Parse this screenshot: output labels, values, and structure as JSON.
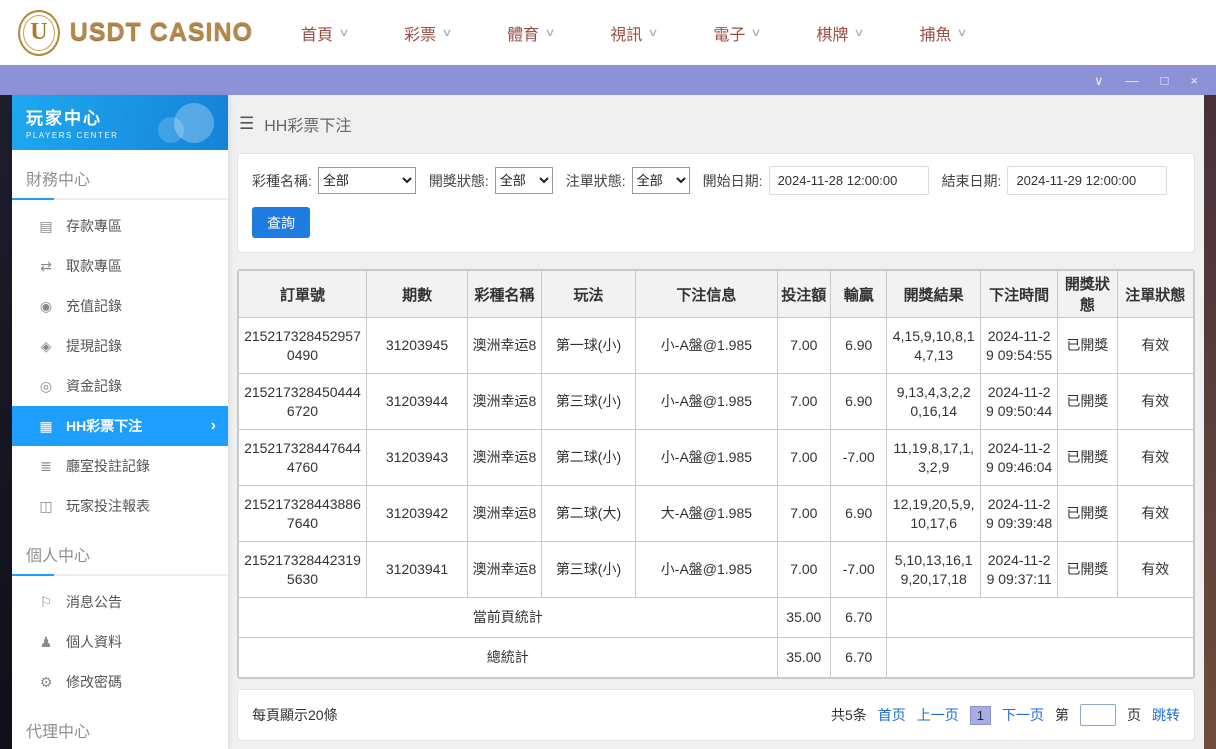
{
  "brand": {
    "logo_text": "USDT CASINO",
    "logo_letter": "U"
  },
  "top_nav": {
    "items": [
      "首頁",
      "彩票",
      "體育",
      "視訊",
      "電子",
      "棋牌",
      "捕魚"
    ]
  },
  "window_controls": {
    "collapse": "∨",
    "minimize": "—",
    "maximize": "□",
    "close": "×"
  },
  "sidebar": {
    "title": "玩家中心",
    "subtitle": "PLAYERS CENTER",
    "sections": [
      {
        "label": "財務中心",
        "items": [
          {
            "label": "存款專區",
            "icon_glyph": "▤"
          },
          {
            "label": "取款專區",
            "icon_glyph": "⇄"
          },
          {
            "label": "充值記錄",
            "icon_glyph": "◉"
          },
          {
            "label": "提現記錄",
            "icon_glyph": "◈"
          },
          {
            "label": "資金記錄",
            "icon_glyph": "◎"
          },
          {
            "label": "HH彩票下注",
            "icon_glyph": "▦",
            "chevron": "›"
          },
          {
            "label": "廳室投註記錄",
            "icon_glyph": "≣"
          },
          {
            "label": "玩家投注報表",
            "icon_glyph": "◫"
          }
        ]
      },
      {
        "label": "個人中心",
        "items": [
          {
            "label": "消息公告",
            "icon_glyph": "⚐"
          },
          {
            "label": "個人資料",
            "icon_glyph": "♟"
          },
          {
            "label": "修改密碼",
            "icon_glyph": "⚙"
          }
        ]
      },
      {
        "label": "代理中心",
        "items": []
      }
    ]
  },
  "page": {
    "title": "HH彩票下注",
    "filters": {
      "lottery_label": "彩種名稱:",
      "lottery_value": "全部",
      "draw_status_label": "開獎狀態:",
      "draw_status_value": "全部",
      "order_status_label": "注單狀態:",
      "order_status_value": "全部",
      "start_label": "開始日期:",
      "start_value": "2024-11-28 12:00:00",
      "end_label": "結束日期:",
      "end_value": "2024-11-29 12:00:00",
      "query_label": "查詢"
    },
    "table": {
      "columns": [
        "訂單號",
        "期數",
        "彩種名稱",
        "玩法",
        "下注信息",
        "投注額",
        "輸贏",
        "開獎結果",
        "下注時間",
        "開獎狀態",
        "注單狀態"
      ],
      "rows": [
        [
          "2152173284529570490",
          "31203945",
          "澳洲幸运8",
          "第一球(小)",
          "小-A盤@1.985",
          "7.00",
          "6.90",
          "4,15,9,10,8,14,7,13",
          "2024-11-29 09:54:55",
          "已開獎",
          "有效"
        ],
        [
          "2152173284504446720",
          "31203944",
          "澳洲幸运8",
          "第三球(小)",
          "小-A盤@1.985",
          "7.00",
          "6.90",
          "9,13,4,3,2,20,16,14",
          "2024-11-29 09:50:44",
          "已開獎",
          "有效"
        ],
        [
          "2152173284476444760",
          "31203943",
          "澳洲幸运8",
          "第二球(小)",
          "小-A盤@1.985",
          "7.00",
          "-7.00",
          "11,19,8,17,1,3,2,9",
          "2024-11-29 09:46:04",
          "已開獎",
          "有效"
        ],
        [
          "2152173284438867640",
          "31203942",
          "澳洲幸运8",
          "第二球(大)",
          "大-A盤@1.985",
          "7.00",
          "6.90",
          "12,19,20,5,9,10,17,6",
          "2024-11-29 09:39:48",
          "已開獎",
          "有效"
        ],
        [
          "2152173284423195630",
          "31203941",
          "澳洲幸运8",
          "第三球(小)",
          "小-A盤@1.985",
          "7.00",
          "-7.00",
          "5,10,13,16,19,20,17,18",
          "2024-11-29 09:37:11",
          "已開獎",
          "有效"
        ]
      ],
      "summary": [
        {
          "label": "當前頁統計",
          "bet": "35.00",
          "win": "6.70"
        },
        {
          "label": "總統計",
          "bet": "35.00",
          "win": "6.70"
        }
      ]
    },
    "pagination": {
      "page_size_text": "每頁顯示20條",
      "total_text": "共5条",
      "first": "首页",
      "prev": "上一页",
      "current": "1",
      "next": "下一页",
      "jump_prefix": "第",
      "jump_suffix": "页",
      "jump_action": "跳转"
    }
  },
  "colors": {
    "accent_blue": "#1e9fff",
    "titlebar_purple": "#8d91d8",
    "link_blue": "#1a6edb",
    "nav_red": "#9a4f46",
    "gold": "#b5884a"
  }
}
